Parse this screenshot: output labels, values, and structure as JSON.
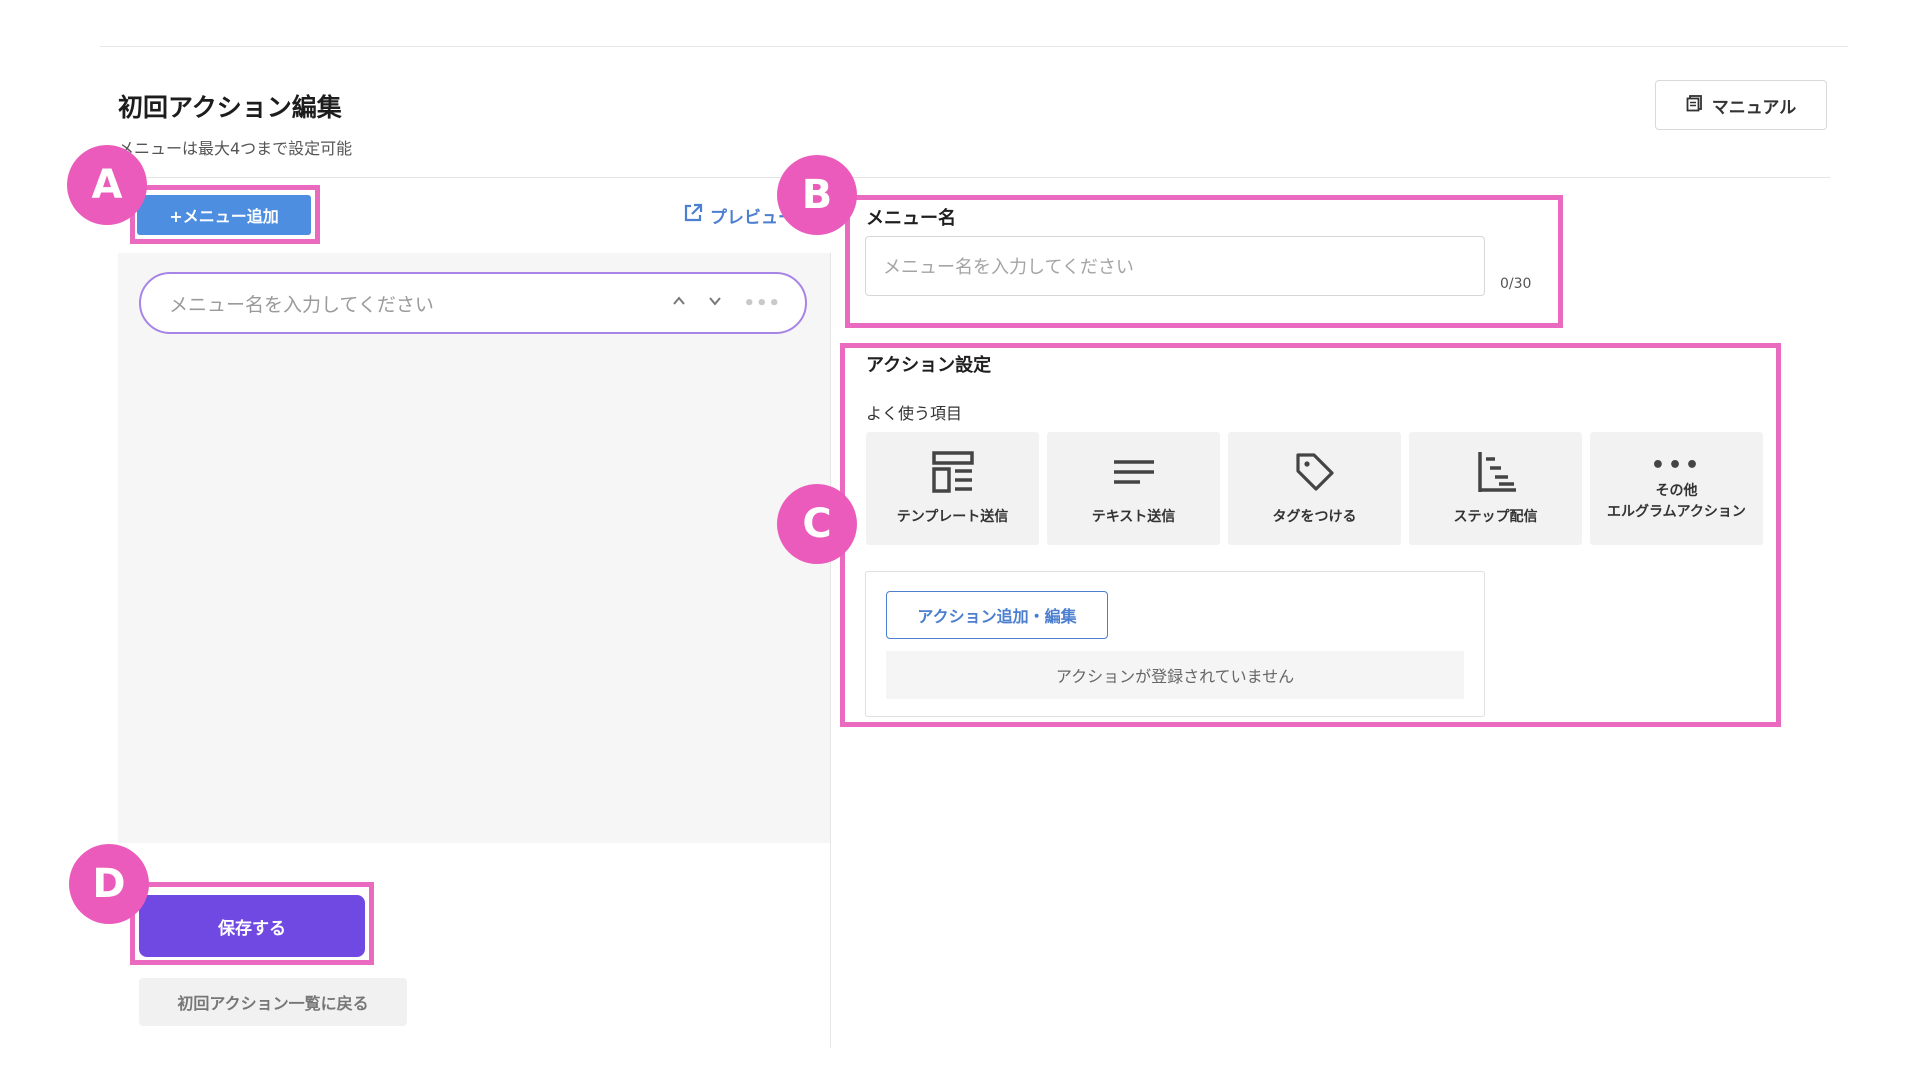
{
  "header": {
    "title": "初回アクション編集",
    "subtitle": "メニューは最大4つまで設定可能",
    "manual_label": "マニュアル"
  },
  "left": {
    "add_menu_label": "+メニュー追加",
    "preview_label": "プレビュー",
    "menu_row_placeholder": "メニュー名を入力してください",
    "save_label": "保存する",
    "back_label": "初回アクション一覧に戻る"
  },
  "menu_name": {
    "label": "メニュー名",
    "placeholder": "メニュー名を入力してください",
    "count": "0/30"
  },
  "action_settings": {
    "label": "アクション設定",
    "frequent_label": "よく使う項目",
    "tiles": [
      {
        "icon": "template-icon",
        "label": "テンプレート送信"
      },
      {
        "icon": "text-lines-icon",
        "label": "テキスト送信"
      },
      {
        "icon": "tag-icon",
        "label": "タグをつける"
      },
      {
        "icon": "step-icon",
        "label": "ステップ配信"
      },
      {
        "icon": "more-dots-icon",
        "label_line1": "その他",
        "label_line2": "エルグラムアクション"
      }
    ],
    "add_edit_label": "アクション追加・編集",
    "empty_message": "アクションが登録されていません"
  },
  "annotations": {
    "a": "A",
    "b": "B",
    "c": "C",
    "d": "D"
  },
  "colors": {
    "annotation": "#ea6ac0",
    "primary_blue": "#4d8ee0",
    "save_purple": "#7048e2",
    "menu_row_border": "#a784e6"
  }
}
